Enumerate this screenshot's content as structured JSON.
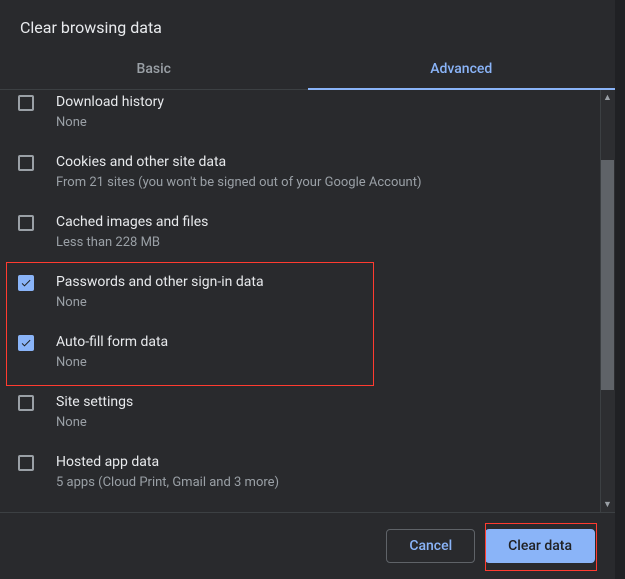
{
  "dialog": {
    "title": "Clear browsing data"
  },
  "tabs": {
    "basic": "Basic",
    "advanced": "Advanced"
  },
  "items": [
    {
      "title": "Download history",
      "sub": "None",
      "checked": false
    },
    {
      "title": "Cookies and other site data",
      "sub": "From 21 sites (you won't be signed out of your Google Account)",
      "checked": false
    },
    {
      "title": "Cached images and files",
      "sub": "Less than 228 MB",
      "checked": false
    },
    {
      "title": "Passwords and other sign-in data",
      "sub": "None",
      "checked": true
    },
    {
      "title": "Auto-fill form data",
      "sub": "None",
      "checked": true
    },
    {
      "title": "Site settings",
      "sub": "None",
      "checked": false
    },
    {
      "title": "Hosted app data",
      "sub": "5 apps (Cloud Print, Gmail and 3 more)",
      "checked": false
    }
  ],
  "footer": {
    "cancel": "Cancel",
    "clear": "Clear data"
  }
}
